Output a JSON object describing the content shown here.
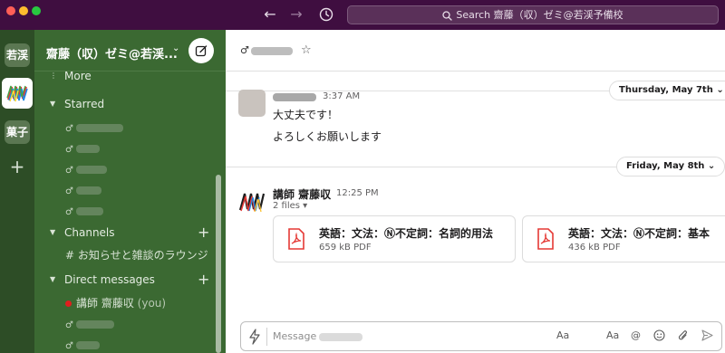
{
  "window": {
    "search_placeholder": "Search 齋藤（収）ゼミ@若渓予備校"
  },
  "rail": {
    "workspaces": [
      {
        "label": "若渓"
      },
      {
        "label": ""
      },
      {
        "label": "菓子"
      }
    ],
    "add_label": "+"
  },
  "sidebar": {
    "workspace_name": "齋藤（収）ゼミ@若渓...",
    "more_label": "More",
    "starred_label": "Starred",
    "channels_label": "Channels",
    "channels": [
      {
        "label": "# お知らせと雑談のラウンジ"
      }
    ],
    "dms_label": "Direct messages",
    "dms": [
      {
        "name": "講師 齋藤収",
        "suffix": "(you)"
      }
    ]
  },
  "channel": {
    "star": "☆"
  },
  "messages": [
    {
      "time": "3:37 AM",
      "lines": [
        "大丈夫です！",
        "よろしくお願いします"
      ]
    },
    {
      "author": "講師 齋藤収",
      "time": "12:25 PM",
      "files_label": "2 files",
      "files": [
        {
          "title": "英語：文法：Ⓝ不定詞：名詞的用法",
          "meta": "659 kB PDF"
        },
        {
          "title": "英語：文法：Ⓝ不定詞：基本",
          "meta": "436 kB PDF"
        }
      ]
    }
  ],
  "dividers": [
    {
      "label": "Thursday, May 7th"
    },
    {
      "label": "Friday, May 8th"
    }
  ],
  "composer": {
    "placeholder": "Message",
    "aa_label": "Aa",
    "aa2_label": "Aa",
    "at_label": "@"
  },
  "colors": {
    "titlebar": "#3f0e40",
    "sidebar": "#3b6932",
    "rail": "#2d4d26",
    "pdf": "#e53935",
    "presence": "#e01e1e"
  }
}
